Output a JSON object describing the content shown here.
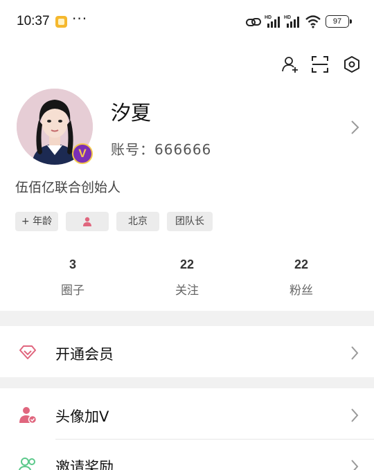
{
  "status_bar": {
    "time": "10:37",
    "battery": "97"
  },
  "top_actions": [
    "add-friend-icon",
    "scan-icon",
    "settings-icon"
  ],
  "profile": {
    "name": "汐夏",
    "account_label": "账号：",
    "account_id": "666666",
    "badge": "V",
    "bio": "伍佰亿联合创始人"
  },
  "tags": [
    {
      "label": "+ 年龄"
    },
    {
      "label": ""
    },
    {
      "label": "北京"
    },
    {
      "label": "团队长"
    }
  ],
  "stats": [
    {
      "value": "3",
      "label": "圈子"
    },
    {
      "value": "22",
      "label": "关注"
    },
    {
      "value": "22",
      "label": "粉丝"
    }
  ],
  "menu": {
    "membership": "开通会员",
    "avatar_v": "头像加V",
    "invite": "邀请奖励"
  },
  "colors": {
    "accent_pink": "#e0667e",
    "accent_green": "#5cc98b",
    "badge_purple": "#7b2fb5",
    "badge_gold": "#f3c94b"
  }
}
